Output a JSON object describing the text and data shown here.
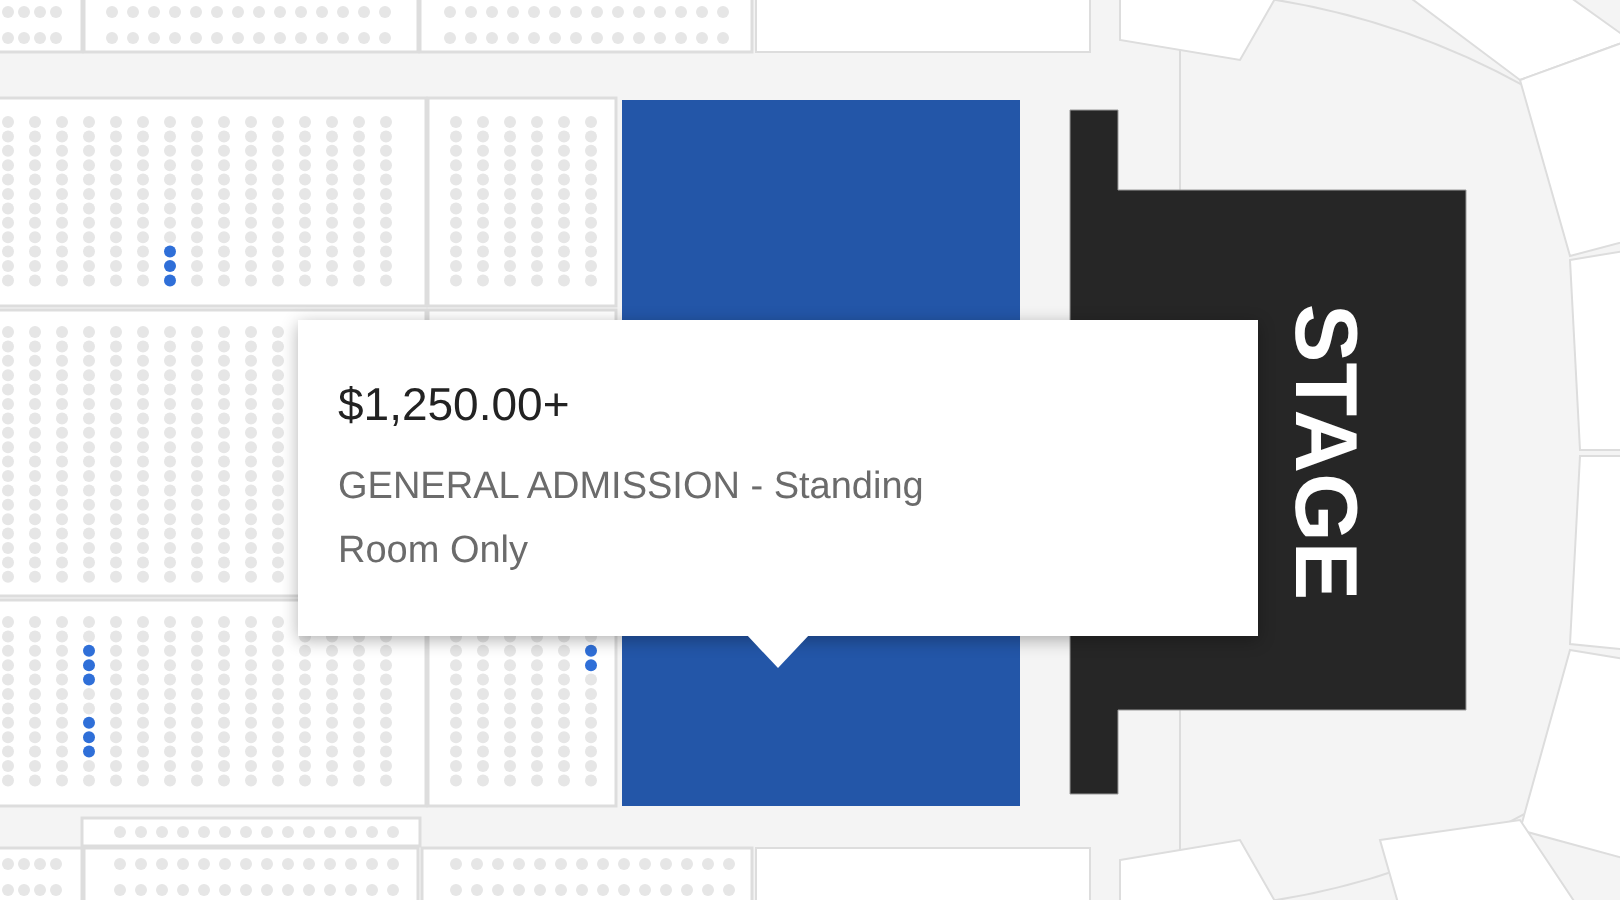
{
  "map": {
    "sections": [
      {
        "kind": "seats"
      },
      {
        "kind": "seats"
      },
      {
        "kind": "seats"
      },
      {
        "kind": "seats",
        "available": true
      },
      {
        "kind": "seats"
      },
      {
        "kind": "seats"
      },
      {
        "kind": "seats"
      },
      {
        "kind": "seats",
        "available": true
      },
      {
        "kind": "seats",
        "available": true
      },
      {
        "kind": "seats"
      },
      {
        "kind": "seats"
      },
      {
        "kind": "seats"
      },
      {
        "kind": "seats"
      }
    ],
    "general_admission": {
      "selected": true
    },
    "stage": {
      "label": "STAGE"
    }
  },
  "tooltip": {
    "price": "$1,250.00+",
    "description": "GENERAL ADMISSION - Standing Room Only"
  }
}
